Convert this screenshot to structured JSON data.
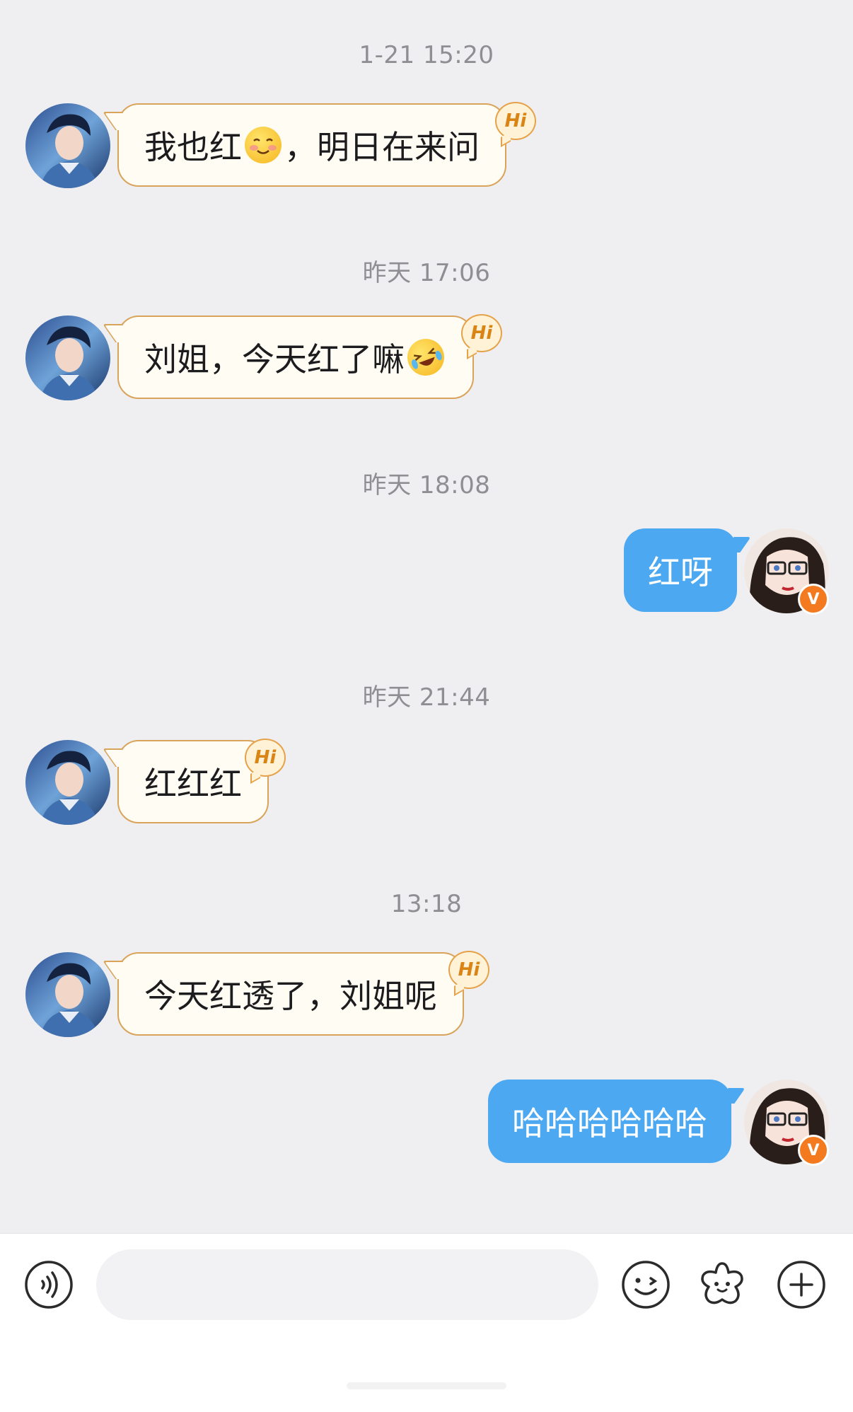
{
  "messages": [
    {
      "timestamp": "1-21 15:20",
      "direction": "incoming",
      "text_before": "我也红",
      "emoji": "smiling-face-emoji",
      "text_after": "，明日在来问",
      "badge": "Hi"
    },
    {
      "timestamp": "昨天 17:06",
      "direction": "incoming",
      "text_before": "刘姐，今天红了嘛",
      "emoji": "rolling-laughing-emoji",
      "text_after": "",
      "badge": "Hi"
    },
    {
      "timestamp": "昨天 18:08",
      "direction": "outgoing",
      "text": "红呀",
      "badge": "V"
    },
    {
      "timestamp": "昨天 21:44",
      "direction": "incoming",
      "text": "红红红",
      "badge": "Hi"
    },
    {
      "timestamp": "13:18",
      "direction": "incoming",
      "text": "今天红透了，刘姐呢",
      "badge": "Hi"
    },
    {
      "direction": "outgoing",
      "text": "哈哈哈哈哈哈",
      "badge": "V"
    }
  ],
  "input_bar": {
    "placeholder": "",
    "icons": [
      "voice-icon",
      "emoji-icon",
      "sticker-icon",
      "add-icon"
    ]
  },
  "colors": {
    "background": "#efeff1",
    "incoming_bubble": "#fffcf3",
    "incoming_border": "#d9a35a",
    "outgoing_bubble": "#4ba8f1",
    "badge_orange": "#f47a1f"
  }
}
